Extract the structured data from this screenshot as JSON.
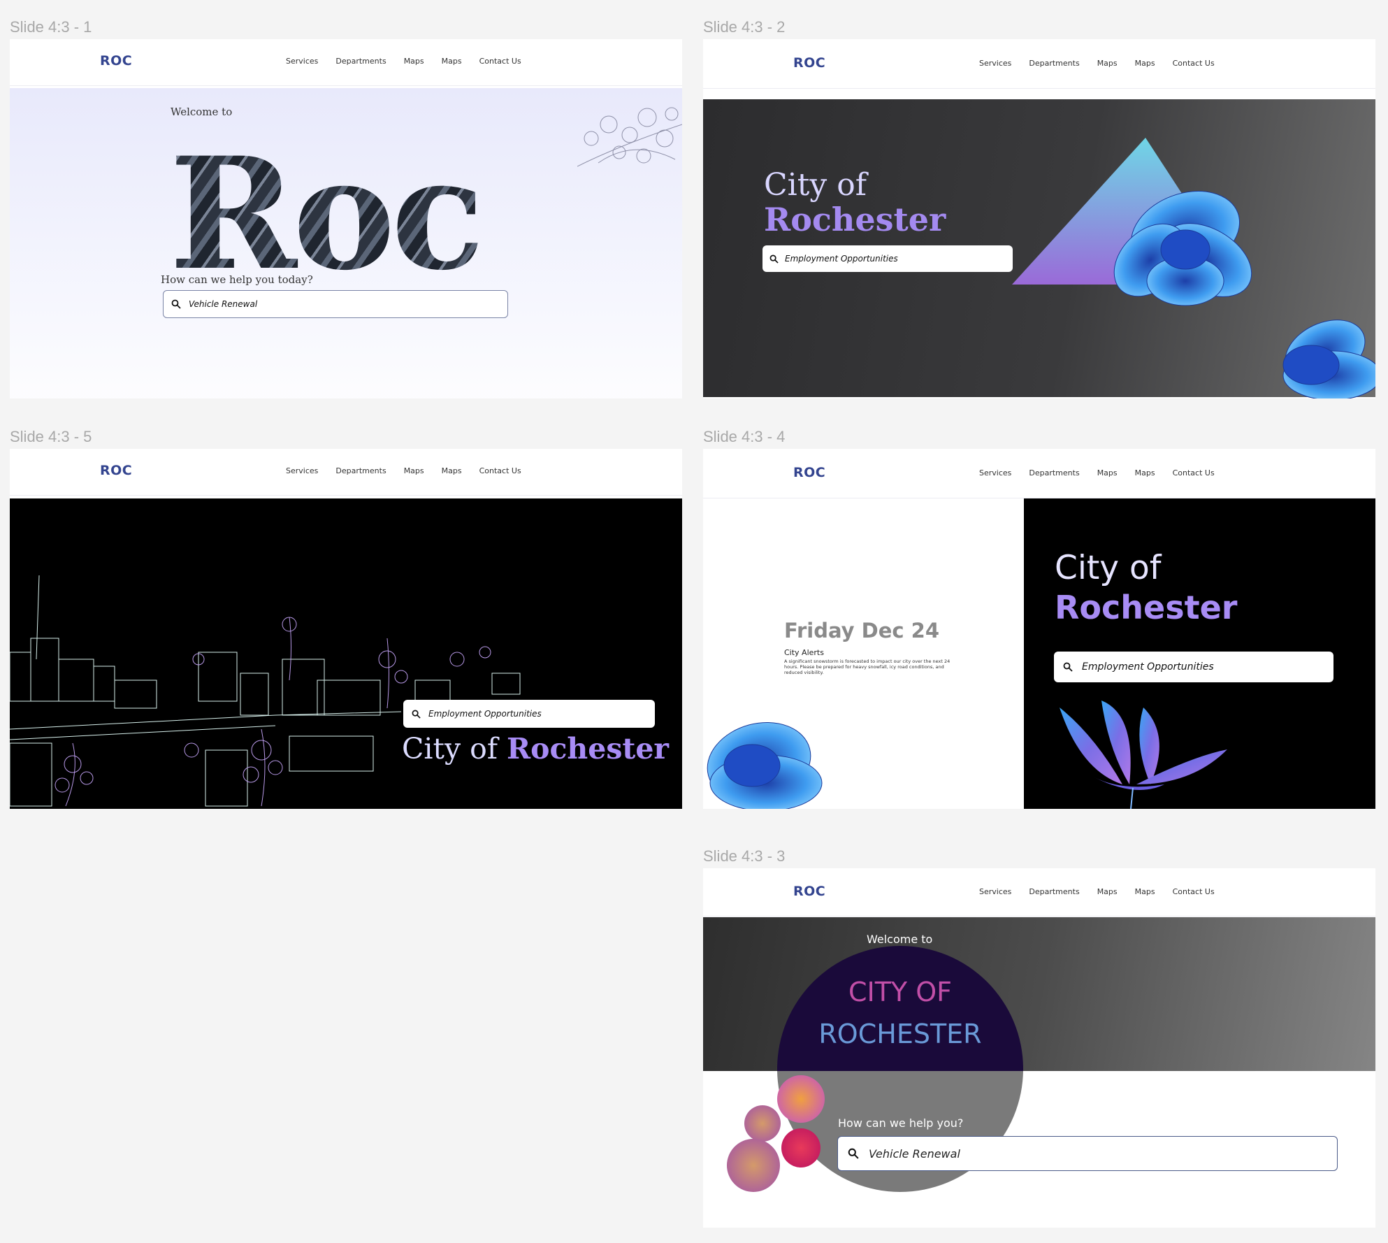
{
  "frames": {
    "s1": {
      "label": "Slide 4:3 - 1"
    },
    "s2": {
      "label": "Slide 4:3 - 2"
    },
    "s5": {
      "label": "Slide 4:3 - 5"
    },
    "s4": {
      "label": "Slide 4:3 - 4"
    },
    "s3": {
      "label": "Slide 4:3 - 3"
    }
  },
  "nav": {
    "logo": "ROC",
    "items": [
      "Services",
      "Departments",
      "Maps",
      "Maps",
      "Contact Us"
    ]
  },
  "slide1": {
    "welcome": "Welcome to",
    "big_title": "Roc",
    "help_prompt": "How can we help you today?",
    "search_value": "Vehicle Renewal"
  },
  "slide2": {
    "title_line1": "City of",
    "title_line2": "Rochester",
    "search_value": "Employment Opportunities"
  },
  "slide5": {
    "search_value": "Employment Opportunities",
    "title_prefix": "City of ",
    "title_accent": "Rochester"
  },
  "slide4": {
    "date": "Friday Dec 24",
    "alerts_title": "City Alerts",
    "alerts_body": "A significant snowstorm is forecasted to impact our city over the next 24 hours. Please be prepared for heavy snowfall, icy road conditions, and reduced visibility.",
    "title_line1": "City of",
    "title_line2": "Rochester",
    "search_value": "Employment Opportunities"
  },
  "slide3": {
    "welcome": "Welcome to",
    "title_line1": "CITY OF",
    "title_line2": "ROCHESTER",
    "help_prompt": "How can we help you?",
    "search_value": "Vehicle Renewal"
  },
  "icons": {
    "search": "search-icon"
  },
  "colors": {
    "logo": "#33448f",
    "accent_purple": "#a88cf5",
    "page_bg": "#f4f4f4"
  }
}
